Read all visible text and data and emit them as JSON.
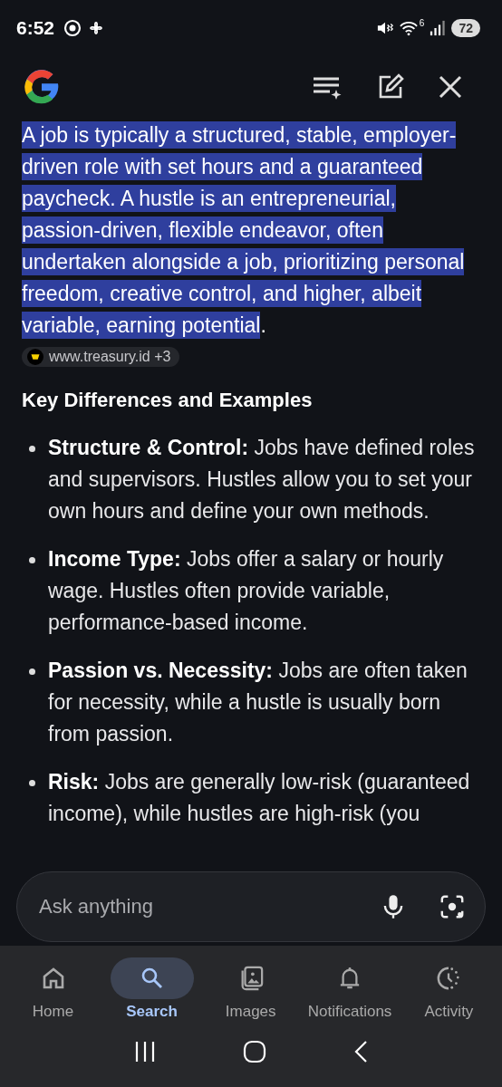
{
  "status_bar": {
    "time": "6:52",
    "wifi_label": "6",
    "battery": "72"
  },
  "answer": {
    "text": "A job is typically a structured, stable, employer-driven role with set hours and a guaranteed paycheck. A hustle is an entrepreneurial, passion-driven, flexible endeavor, often undertaken alongside a job, prioritizing personal freedom, creative control, and higher, albeit variable, earning potential",
    "highlighted": true,
    "trail": ".",
    "source": "www.treasury.id +3"
  },
  "heading": "Key Differences and Examples",
  "bullets": [
    {
      "term": "Structure & Control:",
      "text": "Jobs have defined roles and supervisors. Hustles allow you to set your own hours and define your own methods."
    },
    {
      "term": "Income Type:",
      "text": "Jobs offer a salary or hourly wage. Hustles often provide variable, performance-based income."
    },
    {
      "term": "Passion vs. Necessity:",
      "text": "Jobs are often taken for necessity, while a hustle is usually born from passion."
    },
    {
      "term": "Risk:",
      "text": "Jobs are generally low-risk (guaranteed income), while hustles are high-risk (you"
    }
  ],
  "search": {
    "placeholder": "Ask anything"
  },
  "nav": [
    {
      "kind": "home",
      "label": "Home",
      "selected": false
    },
    {
      "kind": "search",
      "label": "Search",
      "selected": true
    },
    {
      "kind": "images",
      "label": "Images",
      "selected": false
    },
    {
      "kind": "notifications",
      "label": "Notifications",
      "selected": false
    },
    {
      "kind": "activity",
      "label": "Activity",
      "selected": false
    }
  ]
}
